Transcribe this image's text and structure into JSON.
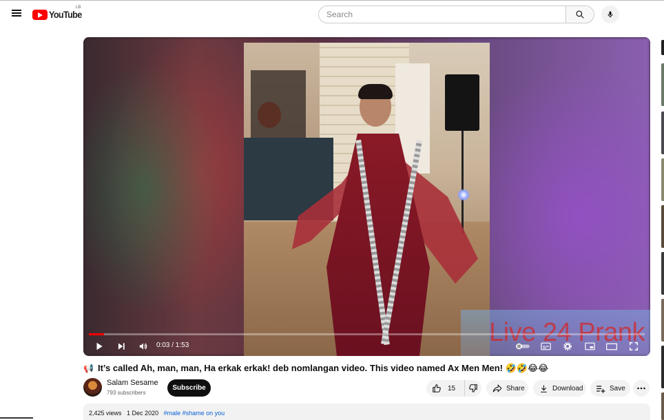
{
  "header": {
    "logo_text": "YouTube",
    "country_code": "LB",
    "search": {
      "placeholder": "Search",
      "value": ""
    }
  },
  "player": {
    "current_time": "0:03",
    "duration": "1:53",
    "time_display": "0:03 / 1:53",
    "progress_fraction": 0.027,
    "watermark": "Live 24 Prank"
  },
  "video": {
    "title_emoji": "📢",
    "title": "It’s called Ah, man, man, Ha erkak erkak! deb nomlangan video. This video named Ax Men Men! 🤣🤣😂😂",
    "channel_name": "Salam Sesame",
    "subscribers": "793 subscribers",
    "subscribe_label": "Subscribe",
    "like_count": "15",
    "share_label": "Share",
    "download_label": "Download",
    "save_label": "Save",
    "views": "2,425 views",
    "date": "1 Dec 2020",
    "hashtags": "#male #shame on you"
  },
  "colors": {
    "accent_red": "#ff0000",
    "link_blue": "#065fd4",
    "pill_bg": "#f2f2f2"
  },
  "icons": [
    "menu-icon",
    "search-icon",
    "mic-icon",
    "play-icon",
    "next-icon",
    "volume-icon",
    "autoplay-toggle-icon",
    "subtitles-icon",
    "settings-icon",
    "miniplayer-icon",
    "theater-icon",
    "fullscreen-icon",
    "like-icon",
    "dislike-icon",
    "share-icon",
    "download-icon",
    "save-icon",
    "more-icon"
  ]
}
